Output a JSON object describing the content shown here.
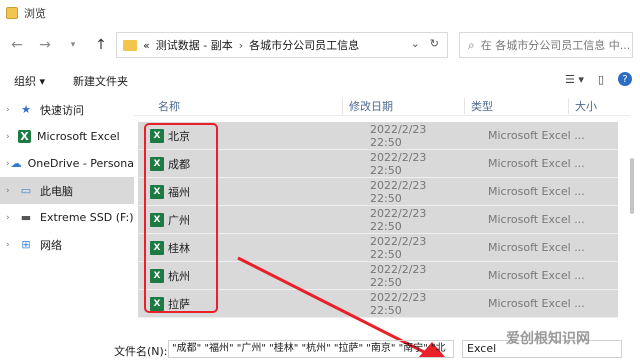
{
  "window": {
    "title": "浏览"
  },
  "address": {
    "overflow": "«",
    "crumbs": [
      "测试数据 - 副本",
      "各城市分公司员工信息"
    ],
    "separator": "›"
  },
  "search": {
    "placeholder": "在 各城市分公司员工信息 中..."
  },
  "toolbar": {
    "organize": "组织 ▾",
    "new_folder": "新建文件夹"
  },
  "sidebar": {
    "items": [
      {
        "label": "快速访问"
      },
      {
        "label": "Microsoft Excel"
      },
      {
        "label": "OneDrive - Persona"
      },
      {
        "label": "此电脑"
      },
      {
        "label": "Extreme SSD (F:)"
      },
      {
        "label": "网络"
      }
    ]
  },
  "filelist": {
    "columns": {
      "name": "名称",
      "date": "修改日期",
      "type": "类型",
      "size": "大小"
    },
    "rows": [
      {
        "name": "北京",
        "date": "2022/2/23 22:50",
        "type": "Microsoft Excel ..."
      },
      {
        "name": "成都",
        "date": "2022/2/23 22:50",
        "type": "Microsoft Excel ..."
      },
      {
        "name": "福州",
        "date": "2022/2/23 22:50",
        "type": "Microsoft Excel ..."
      },
      {
        "name": "广州",
        "date": "2022/2/23 22:50",
        "type": "Microsoft Excel ..."
      },
      {
        "name": "桂林",
        "date": "2022/2/23 22:50",
        "type": "Microsoft Excel ..."
      },
      {
        "name": "杭州",
        "date": "2022/2/23 22:50",
        "type": "Microsoft Excel ..."
      },
      {
        "name": "拉萨",
        "date": "2022/2/23 22:50",
        "type": "Microsoft Excel ..."
      }
    ]
  },
  "bottom": {
    "filename_label": "文件名(N):",
    "filename_value": "\"成都\" \"福州\" \"广州\" \"桂林\" \"杭州\" \"拉萨\" \"南京\" \"南宁\" \"北",
    "filter_value": "Excel"
  },
  "watermark": "爱创根知识网",
  "colors": {
    "highlight": "#e8202a",
    "selected_row": "#d9d9d9",
    "excel_green": "#1d7a43"
  }
}
